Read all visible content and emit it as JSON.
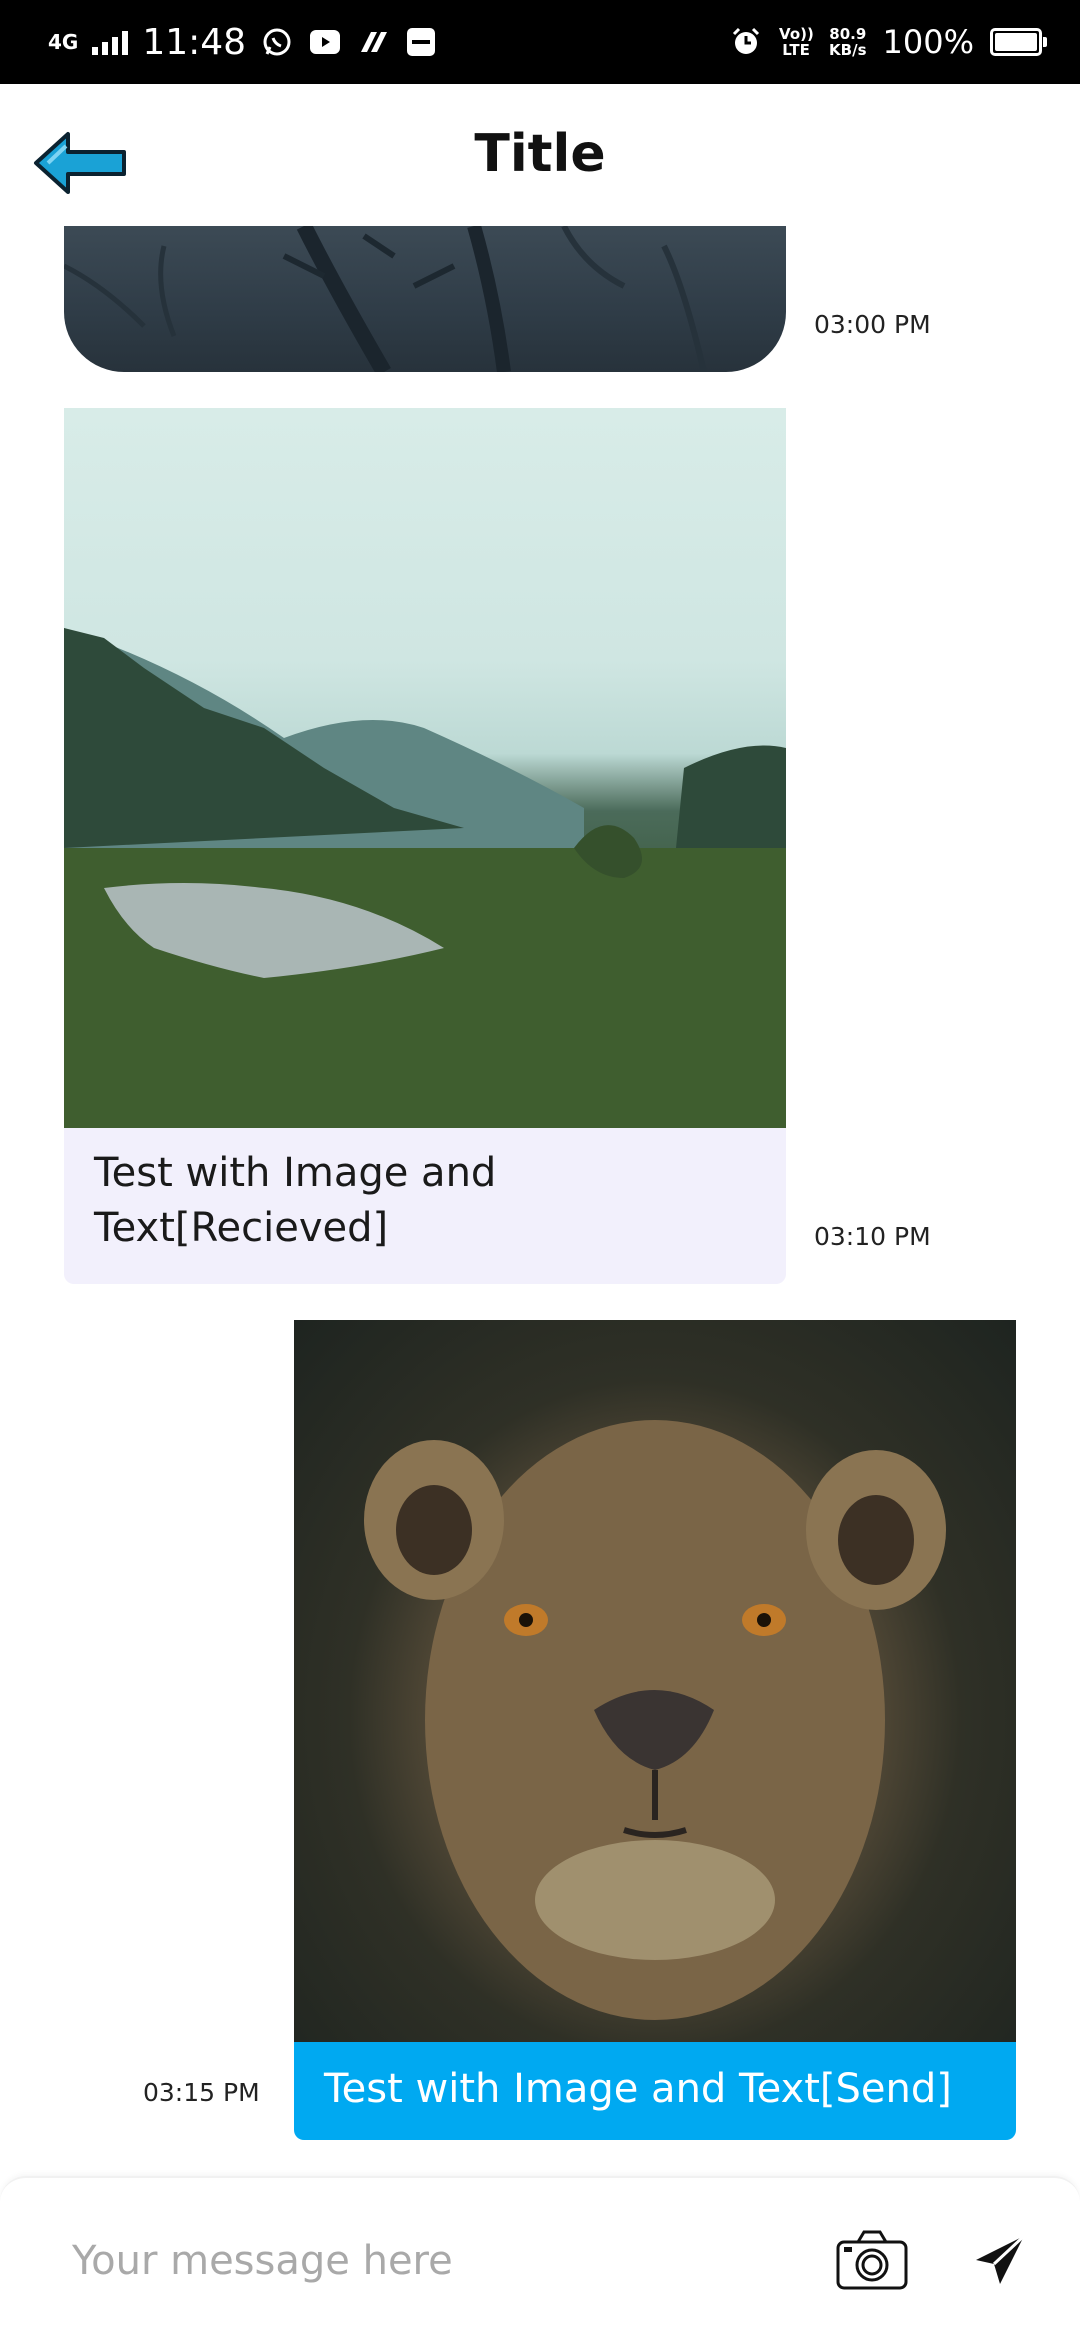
{
  "status_bar": {
    "network": "4G",
    "time": "11:48",
    "volte": "Vo)) LTE",
    "speed_value": "80.9",
    "speed_unit": "KB/s",
    "battery_percent": "100%",
    "battery_level": 1.0,
    "icons": [
      "whatsapp-icon",
      "youtube-icon",
      "payments-icon",
      "paytm-icon",
      "alarm-icon"
    ]
  },
  "header": {
    "title": "Title",
    "back_icon": "back-arrow-icon"
  },
  "messages": [
    {
      "type": "image",
      "direction": "received",
      "image": "forest-night-photo",
      "time": "03:00 PM"
    },
    {
      "type": "image_text",
      "direction": "received",
      "image": "lake-valley-photo",
      "text": "Test with Image and Text[Recieved]",
      "time": "03:10 PM"
    },
    {
      "type": "image_text",
      "direction": "sent",
      "image": "lioness-photo",
      "text": "Test with Image and Text[Send]",
      "time": "03:15 PM"
    }
  ],
  "composer": {
    "placeholder": "Your message here",
    "camera_icon": "camera-icon",
    "send_icon": "send-icon"
  },
  "colors": {
    "received_bubble": "#f2f0fc",
    "sent_bubble": "#00a9f1",
    "back_arrow": "#1aa2d6"
  }
}
